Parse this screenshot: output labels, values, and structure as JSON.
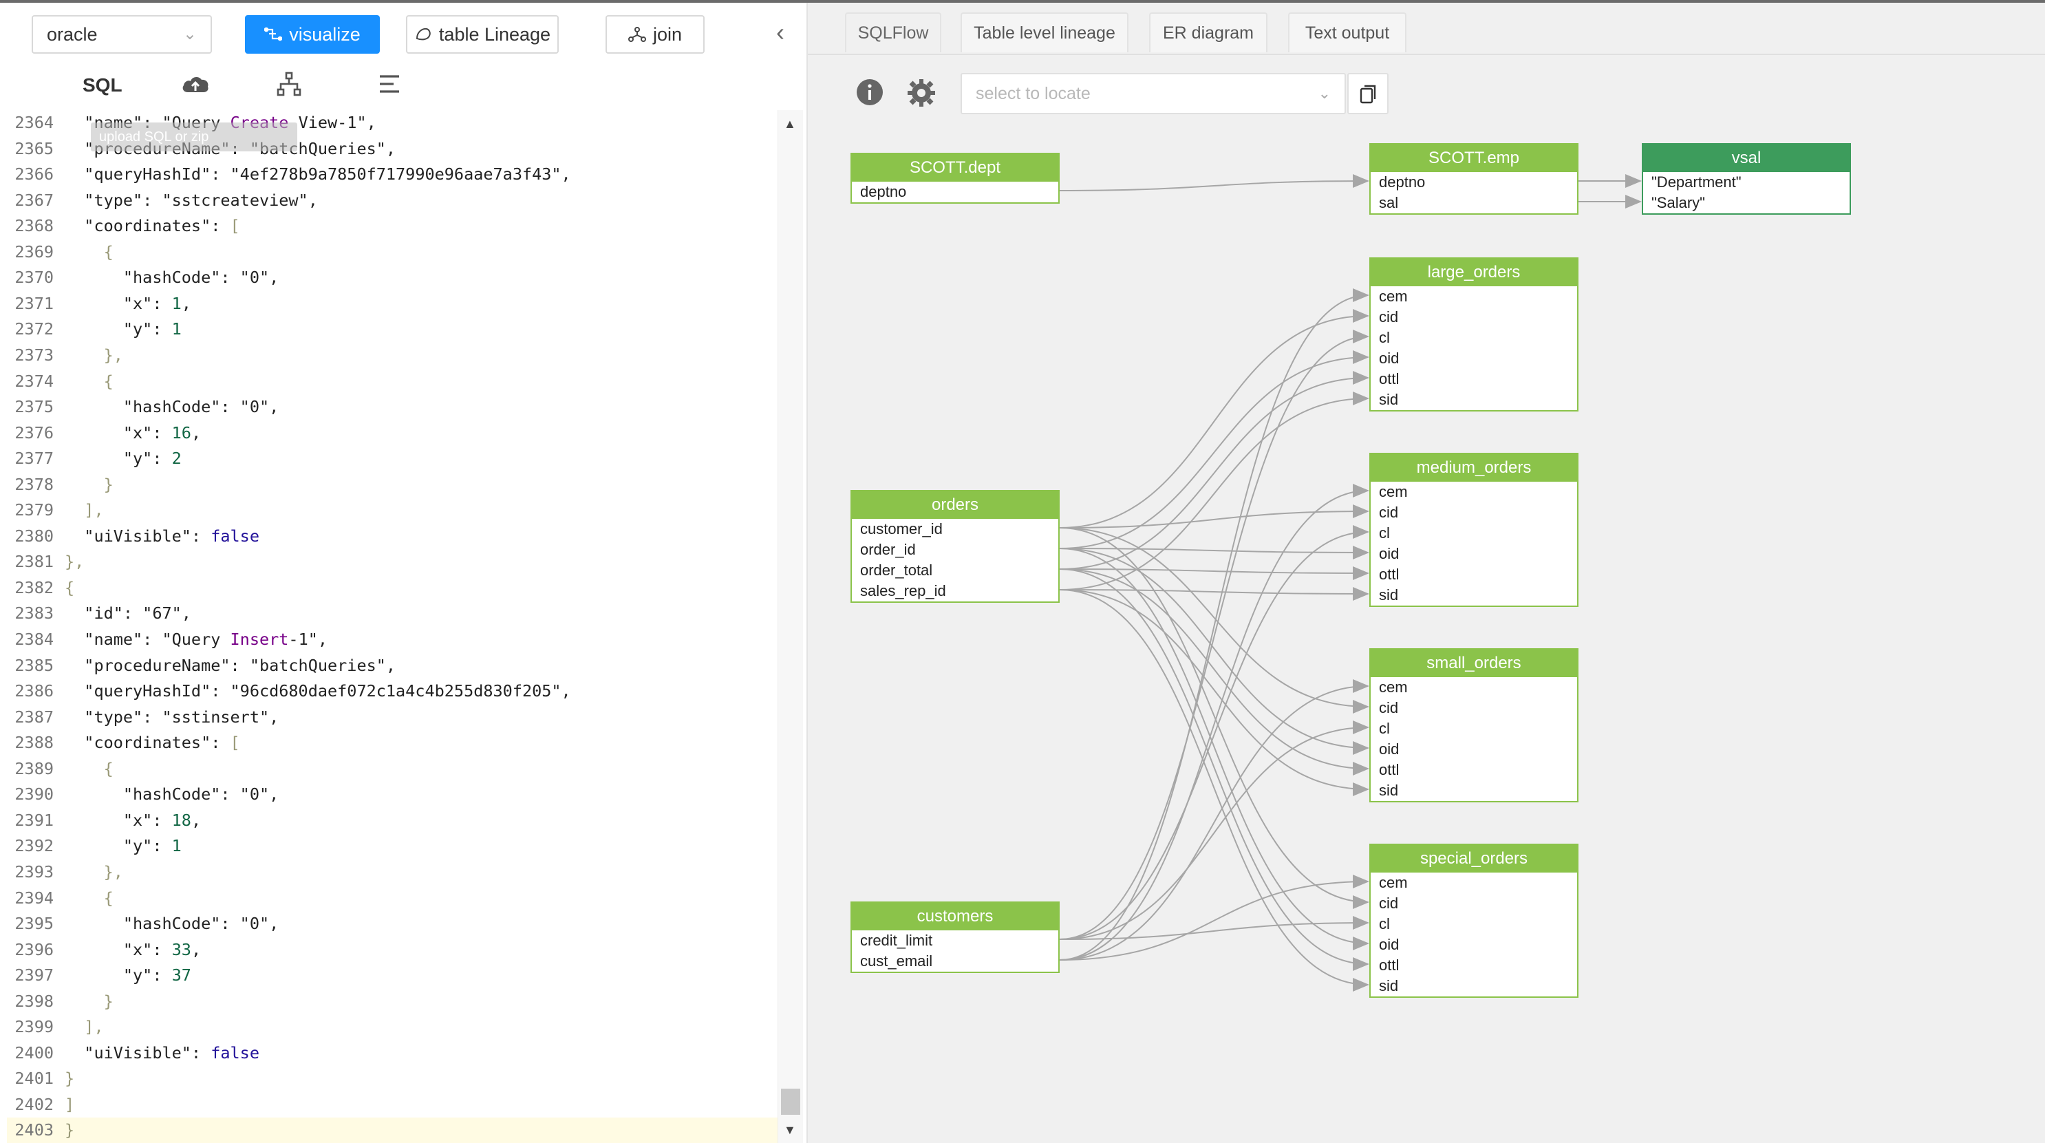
{
  "toolbar": {
    "db_select": "oracle",
    "visualize_label": "visualize",
    "table_lineage_label": "table Lineage",
    "join_label": "join"
  },
  "iconbar": {
    "sql_label": "SQL"
  },
  "editor": {
    "ghost_tip": "upload SQL or zip",
    "lines": [
      {
        "num": "2364",
        "parts": [
          [
            "",
            "  \"name\": \"Query "
          ],
          [
            "k",
            "Create"
          ],
          [
            "",
            " View-1\","
          ]
        ]
      },
      {
        "num": "2365",
        "parts": [
          [
            "",
            "  \"procedureName\": \"batchQueries\","
          ]
        ]
      },
      {
        "num": "2366",
        "parts": [
          [
            "",
            "  \"queryHashId\": \"4ef278b9a7850f717990e96aae7a3f43\","
          ]
        ]
      },
      {
        "num": "2367",
        "parts": [
          [
            "",
            "  \"type\": \"sstcreateview\","
          ]
        ]
      },
      {
        "num": "2368",
        "parts": [
          [
            "",
            "  \"coordinates\": "
          ],
          [
            "br",
            "["
          ]
        ]
      },
      {
        "num": "2369",
        "parts": [
          [
            "br",
            "    {"
          ]
        ]
      },
      {
        "num": "2370",
        "parts": [
          [
            "",
            "      \"hashCode\": \"0\","
          ]
        ]
      },
      {
        "num": "2371",
        "parts": [
          [
            "",
            "      \"x\": "
          ],
          [
            "n",
            "1"
          ],
          [
            "",
            ","
          ]
        ]
      },
      {
        "num": "2372",
        "parts": [
          [
            "",
            "      \"y\": "
          ],
          [
            "n",
            "1"
          ]
        ]
      },
      {
        "num": "2373",
        "parts": [
          [
            "br",
            "    },"
          ]
        ]
      },
      {
        "num": "2374",
        "parts": [
          [
            "br",
            "    {"
          ]
        ]
      },
      {
        "num": "2375",
        "parts": [
          [
            "",
            "      \"hashCode\": \"0\","
          ]
        ]
      },
      {
        "num": "2376",
        "parts": [
          [
            "",
            "      \"x\": "
          ],
          [
            "n",
            "16"
          ],
          [
            "",
            ","
          ]
        ]
      },
      {
        "num": "2377",
        "parts": [
          [
            "",
            "      \"y\": "
          ],
          [
            "n",
            "2"
          ]
        ]
      },
      {
        "num": "2378",
        "parts": [
          [
            "br",
            "    }"
          ]
        ]
      },
      {
        "num": "2379",
        "parts": [
          [
            "br",
            "  ],"
          ]
        ]
      },
      {
        "num": "2380",
        "parts": [
          [
            "",
            "  \"uiVisible\": "
          ],
          [
            "a",
            "false"
          ]
        ]
      },
      {
        "num": "2381",
        "parts": [
          [
            "br",
            "},"
          ]
        ]
      },
      {
        "num": "2382",
        "parts": [
          [
            "br",
            "{"
          ]
        ]
      },
      {
        "num": "2383",
        "parts": [
          [
            "",
            "  \"id\": \"67\","
          ]
        ]
      },
      {
        "num": "2384",
        "parts": [
          [
            "",
            "  \"name\": \"Query "
          ],
          [
            "k",
            "Insert"
          ],
          [
            "",
            "-1\","
          ]
        ]
      },
      {
        "num": "2385",
        "parts": [
          [
            "",
            "  \"procedureName\": \"batchQueries\","
          ]
        ]
      },
      {
        "num": "2386",
        "parts": [
          [
            "",
            "  \"queryHashId\": \"96cd680daef072c1a4c4b255d830f205\","
          ]
        ]
      },
      {
        "num": "2387",
        "parts": [
          [
            "",
            "  \"type\": \"sstinsert\","
          ]
        ]
      },
      {
        "num": "2388",
        "parts": [
          [
            "",
            "  \"coordinates\": "
          ],
          [
            "br",
            "["
          ]
        ]
      },
      {
        "num": "2389",
        "parts": [
          [
            "br",
            "    {"
          ]
        ]
      },
      {
        "num": "2390",
        "parts": [
          [
            "",
            "      \"hashCode\": \"0\","
          ]
        ]
      },
      {
        "num": "2391",
        "parts": [
          [
            "",
            "      \"x\": "
          ],
          [
            "n",
            "18"
          ],
          [
            "",
            ","
          ]
        ]
      },
      {
        "num": "2392",
        "parts": [
          [
            "",
            "      \"y\": "
          ],
          [
            "n",
            "1"
          ]
        ]
      },
      {
        "num": "2393",
        "parts": [
          [
            "br",
            "    },"
          ]
        ]
      },
      {
        "num": "2394",
        "parts": [
          [
            "br",
            "    {"
          ]
        ]
      },
      {
        "num": "2395",
        "parts": [
          [
            "",
            "      \"hashCode\": \"0\","
          ]
        ]
      },
      {
        "num": "2396",
        "parts": [
          [
            "",
            "      \"x\": "
          ],
          [
            "n",
            "33"
          ],
          [
            "",
            ","
          ]
        ]
      },
      {
        "num": "2397",
        "parts": [
          [
            "",
            "      \"y\": "
          ],
          [
            "n",
            "37"
          ]
        ]
      },
      {
        "num": "2398",
        "parts": [
          [
            "br",
            "    }"
          ]
        ]
      },
      {
        "num": "2399",
        "parts": [
          [
            "br",
            "  ],"
          ]
        ]
      },
      {
        "num": "2400",
        "parts": [
          [
            "",
            "  \"uiVisible\": "
          ],
          [
            "a",
            "false"
          ]
        ]
      },
      {
        "num": "2401",
        "parts": [
          [
            "br",
            "}"
          ]
        ]
      },
      {
        "num": "2402",
        "parts": [
          [
            "br",
            "]"
          ]
        ]
      },
      {
        "num": "2403",
        "parts": [
          [
            "br",
            "}"
          ]
        ]
      }
    ]
  },
  "tabs": [
    "SQLFlow",
    "Table level lineage",
    "ER diagram",
    "Text output"
  ],
  "active_tab": "SQLFlow",
  "locate_placeholder": "select to locate",
  "colors": {
    "primary": "#1890ff",
    "table_header": "#8bc34a",
    "result_header": "#3d9c5c"
  },
  "tables": [
    {
      "id": "dept",
      "name": "SCOTT.dept",
      "cols": [
        "deptno"
      ],
      "dark": false
    },
    {
      "id": "emp",
      "name": "SCOTT.emp",
      "cols": [
        "deptno",
        "sal"
      ],
      "dark": false
    },
    {
      "id": "vsal",
      "name": "vsal",
      "cols": [
        "\"Department\"",
        "\"Salary\""
      ],
      "dark": true
    },
    {
      "id": "large",
      "name": "large_orders",
      "cols": [
        "cem",
        "cid",
        "cl",
        "oid",
        "ottl",
        "sid"
      ],
      "dark": false
    },
    {
      "id": "medium",
      "name": "medium_orders",
      "cols": [
        "cem",
        "cid",
        "cl",
        "oid",
        "ottl",
        "sid"
      ],
      "dark": false
    },
    {
      "id": "orders",
      "name": "orders",
      "cols": [
        "customer_id",
        "order_id",
        "order_total",
        "sales_rep_id"
      ],
      "dark": false
    },
    {
      "id": "small",
      "name": "small_orders",
      "cols": [
        "cem",
        "cid",
        "cl",
        "oid",
        "ottl",
        "sid"
      ],
      "dark": false
    },
    {
      "id": "customers",
      "name": "customers",
      "cols": [
        "credit_limit",
        "cust_email"
      ],
      "dark": false
    },
    {
      "id": "special",
      "name": "special_orders",
      "cols": [
        "cem",
        "cid",
        "cl",
        "oid",
        "ottl",
        "sid"
      ],
      "dark": false
    }
  ],
  "edges": [
    [
      "dept",
      0,
      "emp",
      0
    ],
    [
      "emp",
      0,
      "vsal",
      0
    ],
    [
      "emp",
      1,
      "vsal",
      1
    ],
    [
      "orders",
      0,
      "large",
      1
    ],
    [
      "orders",
      1,
      "large",
      3
    ],
    [
      "orders",
      2,
      "large",
      4
    ],
    [
      "orders",
      3,
      "large",
      5
    ],
    [
      "customers",
      0,
      "large",
      2
    ],
    [
      "customers",
      1,
      "large",
      0
    ],
    [
      "orders",
      0,
      "medium",
      1
    ],
    [
      "orders",
      1,
      "medium",
      3
    ],
    [
      "orders",
      2,
      "medium",
      4
    ],
    [
      "orders",
      3,
      "medium",
      5
    ],
    [
      "customers",
      0,
      "medium",
      2
    ],
    [
      "customers",
      1,
      "medium",
      0
    ],
    [
      "orders",
      0,
      "small",
      1
    ],
    [
      "orders",
      1,
      "small",
      3
    ],
    [
      "orders",
      2,
      "small",
      4
    ],
    [
      "orders",
      3,
      "small",
      5
    ],
    [
      "customers",
      0,
      "small",
      2
    ],
    [
      "customers",
      1,
      "small",
      0
    ],
    [
      "orders",
      0,
      "special",
      1
    ],
    [
      "orders",
      1,
      "special",
      3
    ],
    [
      "orders",
      2,
      "special",
      4
    ],
    [
      "orders",
      3,
      "special",
      5
    ],
    [
      "customers",
      0,
      "special",
      2
    ],
    [
      "customers",
      1,
      "special",
      0
    ]
  ]
}
